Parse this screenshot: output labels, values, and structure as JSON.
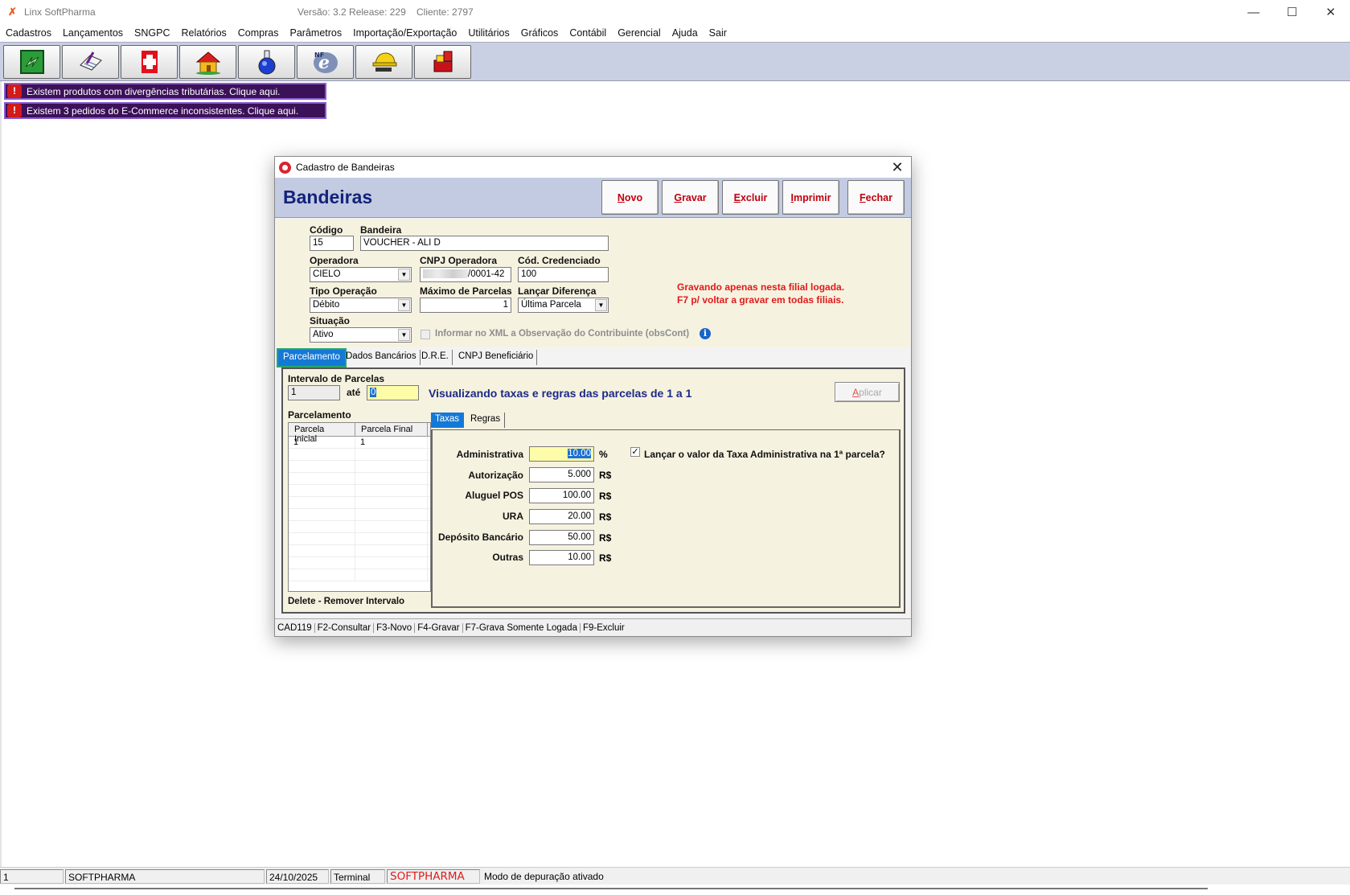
{
  "window": {
    "title": "Linx SoftPharma",
    "version": "Versão: 3.2 Release: 229",
    "client": "Cliente: 2797"
  },
  "menu": [
    "Cadastros",
    "Lançamentos",
    "SNGPC",
    "Relatórios",
    "Compras",
    "Parâmetros",
    "Importação/Exportação",
    "Utilitários",
    "Gráficos",
    "Contábil",
    "Gerencial",
    "Ajuda",
    "Sair"
  ],
  "toolbar_icons": [
    "refresh-tool-icon",
    "edit-document-tool-icon",
    "pharmacy-cross-tool-icon",
    "home-tool-icon",
    "flask-tool-icon",
    "nfe-tool-icon",
    "hardhat-tool-icon",
    "books-tool-icon"
  ],
  "notices": [
    "Existem produtos com divergências tributárias. Clique aqui.",
    "Existem 3 pedidos do E-Commerce inconsistentes. Clique aqui."
  ],
  "dialog": {
    "title": "Cadastro de Bandeiras",
    "heading": "Bandeiras",
    "buttons": {
      "novo": {
        "pre": "",
        "key": "N",
        "post": "ovo"
      },
      "gravar": {
        "pre": "",
        "key": "G",
        "post": "ravar"
      },
      "excluir": {
        "pre": "",
        "key": "E",
        "post": "xcluir"
      },
      "imprimir": {
        "pre": "",
        "key": "I",
        "post": "mprimir"
      },
      "fechar": {
        "pre": "",
        "key": "F",
        "post": "echar"
      }
    },
    "form": {
      "codigo_label": "Código",
      "codigo": "15",
      "bandeira_label": "Bandeira",
      "bandeira": "VOUCHER - ALI D",
      "operadora_label": "Operadora",
      "operadora": "CIELO",
      "cnpj_label": "CNPJ Operadora",
      "cnpj_suffix": "/0001-42",
      "cod_cred_label": "Cód. Credenciado",
      "cod_cred": "100",
      "tipo_label": "Tipo Operação",
      "tipo": "Débito",
      "max_parc_label": "Máximo de Parcelas",
      "max_parc": "1",
      "lancar_dif_label": "Lançar Diferença",
      "lancar_dif": "Última Parcela",
      "situacao_label": "Situação",
      "situacao": "Ativo",
      "xml_obs_label": "Informar no XML a Observação do Contribuinte (obsCont)",
      "warning_line1": "Gravando apenas nesta filial logada.",
      "warning_line2": "F7 p/ voltar a gravar em todas filiais."
    },
    "tabs": [
      "Parcelamento",
      "Dados Bancários",
      "D.R.E.",
      "CNPJ Beneficiário"
    ],
    "parcelamento": {
      "intervalo_label": "Intervalo de Parcelas",
      "de": "1",
      "ate_label": "até",
      "ate": "0",
      "viewing_text": "Visualizando taxas e regras das parcelas de 1 a 1",
      "aplicar_key": "A",
      "aplicar_rest": "plicar",
      "grid_title": "Parcelamento",
      "grid_headers": [
        "Parcela Inicial",
        "Parcela Final"
      ],
      "grid_rows": [
        [
          "1",
          "1"
        ]
      ],
      "delete_hint": "Delete - Remover Intervalo",
      "subtabs": [
        "Taxas",
        "Regras"
      ],
      "taxas": {
        "administrativa_label": "Administrativa",
        "administrativa": "10.00",
        "administrativa_unit": "%",
        "autorizacao_label": "Autorização",
        "autorizacao": "5.000",
        "aluguel_label": "Aluguel POS",
        "aluguel": "100.00",
        "ura_label": "URA",
        "ura": "20.00",
        "deposito_label": "Depósito Bancário",
        "deposito": "50.00",
        "outras_label": "Outras",
        "outras": "10.00",
        "currency_unit": "R$",
        "lancar_taxa_label": "Lançar o valor da Taxa Administrativa na 1ª parcela?",
        "lancar_taxa_checked": true
      }
    },
    "status": [
      "CAD119",
      "F2-Consultar",
      "F3-Novo",
      "F4-Gravar",
      "F7-Grava Somente Logada",
      "F9-Excluir"
    ]
  },
  "statusbar": {
    "cell1": "1",
    "user": "SOFTPHARMA",
    "date": "24/10/2025",
    "terminal": "Terminal",
    "brand": "SOFTPHARMA",
    "mode": "Modo de depuração ativado"
  },
  "colors": {
    "toolbar_bg": "#c9d0e4",
    "notice_bg": "#3b1158",
    "heading_text": "#13237a",
    "button_text": "#c00010",
    "warning": "#e01b1b",
    "tab_active": "#1479d6",
    "form_bg": "#f6f2e0"
  }
}
